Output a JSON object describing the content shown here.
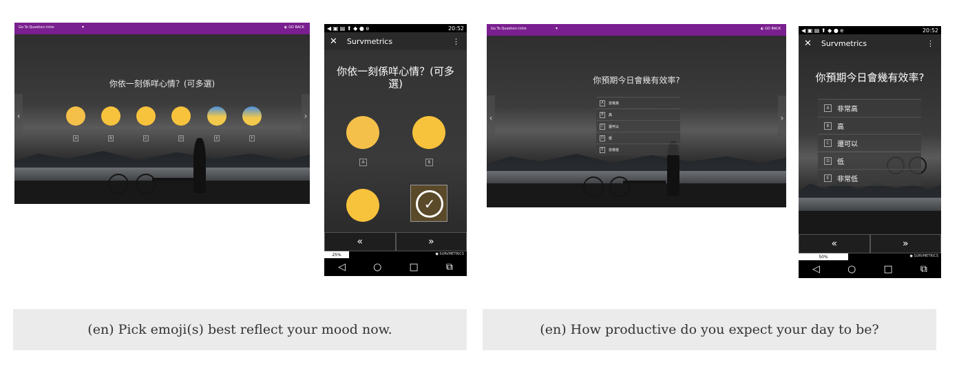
{
  "left_tablet": {
    "goto_label": "Go To Question:",
    "goto_value": "Intro",
    "go_back_label": "GO BACK",
    "question": "你依一刻係咩心情？(可多選)",
    "prev_icon": "chevron-left-icon",
    "next_icon": "chevron-right-icon",
    "emoji_letters": [
      "A",
      "B",
      "C",
      "D",
      "E",
      "F"
    ],
    "emojis": [
      "relieved-face",
      "grinning-face",
      "neutral-face",
      "disappointed-face",
      "anxious-sweat-face",
      "screaming-face"
    ]
  },
  "left_phone": {
    "status_time": "20:52",
    "app_title": "Survmetrics",
    "question": "你依一刻係咩心情？(可多選)",
    "letters": [
      "A",
      "B"
    ],
    "prev_label": "«",
    "next_label": "»",
    "progress_label": "25%",
    "progress_value": 25,
    "brand": "SURVMETRICS"
  },
  "right_tablet": {
    "goto_label": "Go To Question:",
    "goto_value": "Intro",
    "go_back_label": "GO BACK",
    "question": "你預期今日會幾有效率?",
    "options": [
      {
        "letter": "A",
        "text": "非常高"
      },
      {
        "letter": "B",
        "text": "高"
      },
      {
        "letter": "C",
        "text": "還可以"
      },
      {
        "letter": "D",
        "text": "低"
      },
      {
        "letter": "E",
        "text": "非常低"
      }
    ]
  },
  "right_phone": {
    "status_time": "20:52",
    "app_title": "Survmetrics",
    "question": "你預期今日會幾有效率?",
    "options": [
      {
        "letter": "A",
        "text": "非常高"
      },
      {
        "letter": "B",
        "text": "高"
      },
      {
        "letter": "C",
        "text": "還可以"
      },
      {
        "letter": "D",
        "text": "低"
      },
      {
        "letter": "E",
        "text": "非常低"
      }
    ],
    "prev_label": "«",
    "next_label": "»",
    "progress_label": "50%",
    "progress_value": 50,
    "brand": "SURVMETRICS"
  },
  "captions": {
    "left": "(en) Pick emoji(s) best reflect your mood now.",
    "right": "(en) How productive do you expect your day to be?"
  }
}
